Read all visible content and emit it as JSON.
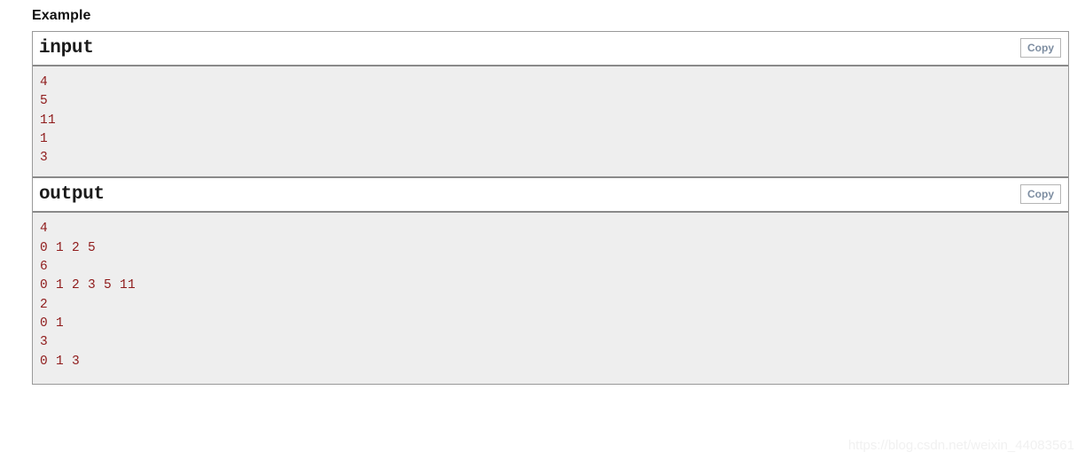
{
  "page": {
    "heading": "Example",
    "watermark": "https://blog.csdn.net/weixin_44083561",
    "colors": {
      "code_text": "#8f1b1b",
      "code_background": "#eeeeee",
      "border": "#8a8a8a",
      "copy_button_text": "#7d8da1",
      "heading_text": "#111111",
      "watermark_text": "#f1f1f1"
    }
  },
  "blocks": [
    {
      "title": "input",
      "copy_label": "Copy",
      "lines": [
        "4",
        "5",
        "11",
        "1",
        "3"
      ]
    },
    {
      "title": "output",
      "copy_label": "Copy",
      "lines": [
        "4",
        "0 1 2 5",
        "6",
        "0 1 2 3 5 11",
        "2",
        "0 1",
        "3",
        "0 1 3"
      ]
    }
  ]
}
